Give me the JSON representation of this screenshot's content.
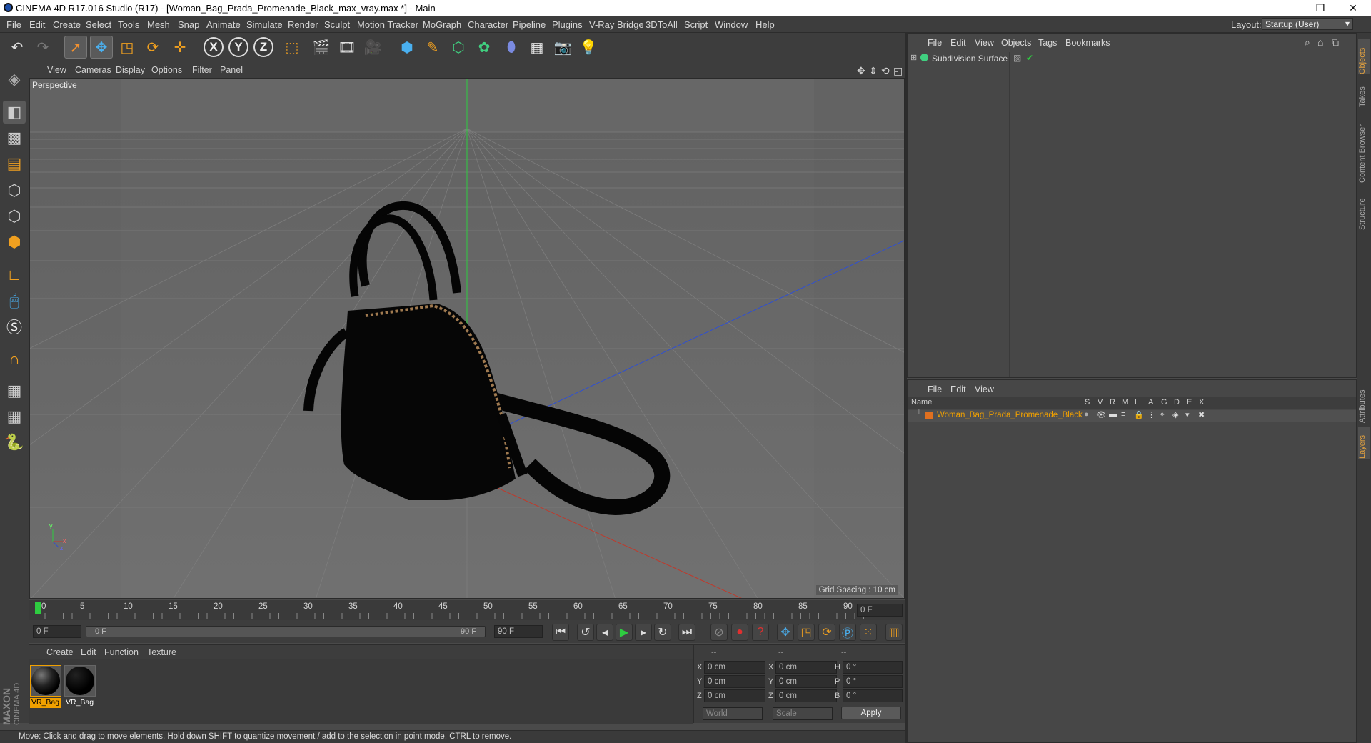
{
  "window": {
    "title": "CINEMA 4D R17.016 Studio (R17) - [Woman_Bag_Prada_Promenade_Black_max_vray.max *] - Main",
    "minimize": "–",
    "restore": "❐",
    "close": "✕"
  },
  "menubar": {
    "items": [
      "File",
      "Edit",
      "Create",
      "Select",
      "Tools",
      "Mesh",
      "Snap",
      "Animate",
      "Simulate",
      "Render",
      "Sculpt",
      "Motion Tracker",
      "MoGraph",
      "Character",
      "Pipeline",
      "Plugins",
      "V-Ray Bridge",
      "3DToAll",
      "Script",
      "Window",
      "Help"
    ],
    "layout_label": "Layout:",
    "layout_value": "Startup (User)"
  },
  "viewport": {
    "menu": [
      "View",
      "Cameras",
      "Display",
      "Options",
      "Filter",
      "Panel"
    ],
    "label": "Perspective",
    "grid_spacing": "Grid Spacing : 10 cm",
    "axis_y": "y",
    "axis_z": "z",
    "axis_x": "x"
  },
  "timeline": {
    "ticks": [
      "0",
      "5",
      "10",
      "15",
      "20",
      "25",
      "30",
      "35",
      "40",
      "45",
      "50",
      "55",
      "60",
      "65",
      "70",
      "75",
      "80",
      "85",
      "90"
    ],
    "current_frame": "0 F",
    "start_field": "0 F",
    "range_start": "0 F",
    "range_end": "90 F",
    "end_field": "90 F"
  },
  "materials": {
    "menu": [
      "Create",
      "Edit",
      "Function",
      "Texture"
    ],
    "items": [
      {
        "name": "VR_Bag",
        "selected": true
      },
      {
        "name": "VR_Bag",
        "selected": false
      }
    ]
  },
  "coordinates": {
    "headers": [
      "--",
      "--",
      "--"
    ],
    "rows": [
      {
        "a": "X",
        "av": "0 cm",
        "b": "X",
        "bv": "0 cm",
        "c": "H",
        "cv": "0 °"
      },
      {
        "a": "Y",
        "av": "0 cm",
        "b": "Y",
        "bv": "0 cm",
        "c": "P",
        "cv": "0 °"
      },
      {
        "a": "Z",
        "av": "0 cm",
        "b": "Z",
        "bv": "0 cm",
        "c": "B",
        "cv": "0 °"
      }
    ],
    "mode1": "World",
    "mode2": "Scale",
    "apply": "Apply"
  },
  "status": {
    "text": "Move: Click and drag to move elements. Hold down SHIFT to quantize movement / add to the selection in point mode, CTRL to remove."
  },
  "objects_panel": {
    "menu": [
      "File",
      "Edit",
      "View",
      "Objects",
      "Tags",
      "Bookmarks"
    ],
    "items": [
      {
        "name": "Subdivision Surface"
      }
    ]
  },
  "layers_panel": {
    "menu": [
      "File",
      "Edit",
      "View"
    ],
    "name_header": "Name",
    "columns": [
      "S",
      "V",
      "R",
      "M",
      "L",
      "A",
      "G",
      "D",
      "E",
      "X"
    ],
    "layers": [
      {
        "name": "Woman_Bag_Prada_Promenade_Black",
        "color": "#e07020"
      }
    ]
  },
  "side_tabs": {
    "right_top": [
      "Objects",
      "Takes",
      "Content Browser",
      "Structure"
    ],
    "right_bottom": [
      "Attributes",
      "Layers"
    ]
  },
  "brand": {
    "maxon": "MAXON",
    "product": "CINEMA 4D"
  },
  "colors": {
    "accent": "#e0a040",
    "selection": "#f0a000",
    "x_axis": "#c0392b",
    "y_axis": "#2ecc40",
    "z_axis": "#3050d0"
  }
}
